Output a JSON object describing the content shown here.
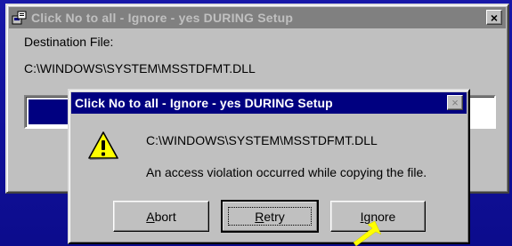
{
  "back_window": {
    "title": "Click No to all - Ignore - yes DURING Setup",
    "close_glyph": "×",
    "label": "Destination File:",
    "path": "C:\\WINDOWS\\SYSTEM\\MSSTDFMT.DLL",
    "progress_fraction": 0.17
  },
  "dialog": {
    "title": "Click No to all - Ignore - yes DURING Setup",
    "close_glyph": "×",
    "icon": "warning-icon",
    "path": "C:\\WINDOWS\\SYSTEM\\MSSTDFMT.DLL",
    "message": "An access violation occurred while copying the file.",
    "buttons": {
      "abort": {
        "mnemonic": "A",
        "rest": "bort"
      },
      "retry": {
        "mnemonic": "R",
        "rest": "etry"
      },
      "ignore": {
        "mnemonic": "I",
        "rest": "gnore"
      }
    }
  },
  "pointer": {
    "icon": "arrow-pointer-icon",
    "color": "#ffff00"
  },
  "colors": {
    "desktop": "#10109a",
    "active_title": "#000080",
    "inactive_title": "#808080",
    "face": "#c0c0c0"
  }
}
